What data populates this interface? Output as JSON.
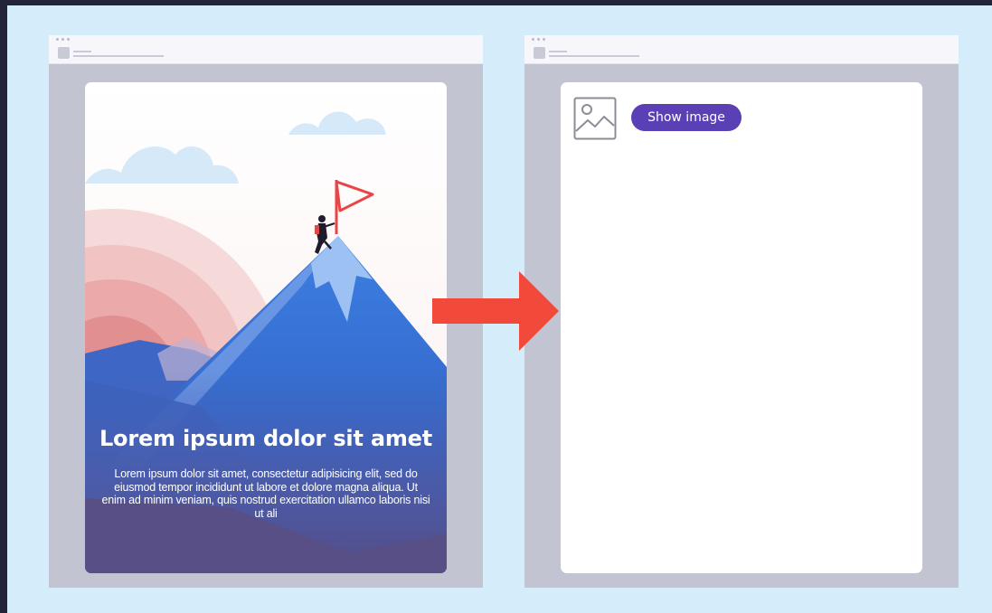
{
  "colors": {
    "backdrop": "#d5ecfb",
    "browser_frame": "#c2c4d2",
    "arrow": "#f24a3a",
    "button": "#5b3fb5",
    "flag": "#e94545"
  },
  "left_panel": {
    "headline": "Lorem ipsum dolor sit amet",
    "body": "Lorem ipsum dolor sit amet, consectetur adipisicing elit, sed do eiusmod tempor incididunt ut labore et dolore magna aliqua. Ut enim ad minim veniam, quis nostrud exercitation ullamco laboris nisi ut ali",
    "hero_icon": "mountain-summit-illustration"
  },
  "right_panel": {
    "placeholder_icon": "image-placeholder-icon",
    "button_label": "Show image"
  },
  "transition_icon": "right-arrow-icon"
}
